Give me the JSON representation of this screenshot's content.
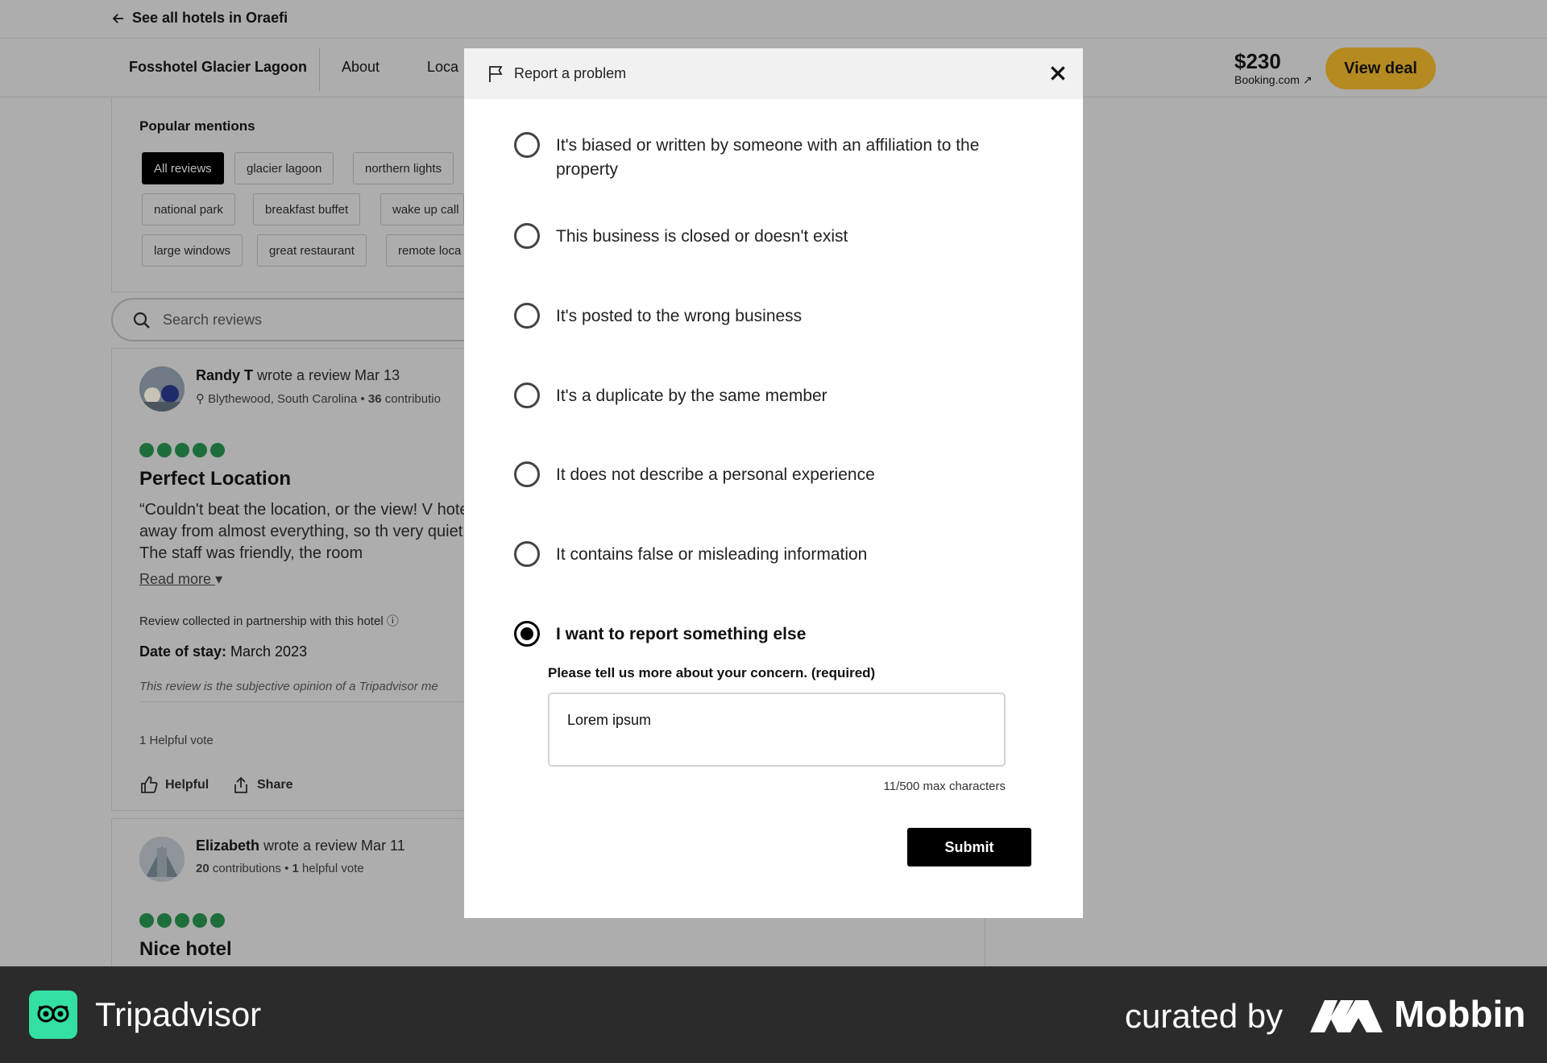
{
  "page": {
    "back_link": "See all hotels in Oraefi",
    "hotel_name": "Fosshotel Glacier Lagoon",
    "tabs": [
      "About",
      "Loca"
    ],
    "price": "$230",
    "price_source": "Booking.com ↗",
    "view_deal": "View deal",
    "popular_mentions_title": "Popular mentions",
    "chips": [
      "All reviews",
      "glacier lagoon",
      "northern lights",
      "national park",
      "breakfast buffet",
      "wake up call",
      "large windows",
      "great restaurant",
      "remote loca"
    ],
    "search_placeholder": "Search reviews"
  },
  "reviews": [
    {
      "name": "Randy T",
      "wrote": " wrote a review Mar 13",
      "location": "Blythewood, South Carolina • ",
      "contrib_count": "36",
      "contrib_label": " contributio",
      "title": "Perfect Location",
      "body": "“Couldn't beat the location, or the view! V hotel is away from almost everything, so th very quiet. The staff was friendly, the room",
      "read_more": "Read more",
      "collected": "Review collected in partnership with this hotel",
      "stay_label": "Date of stay:",
      "stay_value": " March 2023",
      "disclaimer": "This review is the subjective opinion of a Tripadvisor me",
      "helpful_votes": "1 Helpful vote",
      "helpful_btn": "Helpful",
      "share_btn": "Share",
      "rating": 5
    },
    {
      "name": "Elizabeth",
      "wrote": " wrote a review Mar 11",
      "contrib_count": "20",
      "contrib_label": " contributions • ",
      "helpful_count": "1",
      "helpful_label": " helpful vote",
      "title": "Nice hotel",
      "rating": 5
    }
  ],
  "modal": {
    "title": "Report a problem",
    "options": [
      "It's biased or written by someone with an affiliation to the property",
      "This business is closed or doesn't exist",
      "It's posted to the wrong business",
      "It's a duplicate by the same member",
      "It does not describe a personal experience",
      "It contains false or misleading information",
      "I want to report something else"
    ],
    "selected_index": 6,
    "concern_label": "Please tell us more about your concern. (required)",
    "concern_value": "Lorem ipsum",
    "char_count": "11/500 max characters",
    "submit": "Submit"
  },
  "footer": {
    "app_name": "Tripadvisor",
    "curated_by": "curated by",
    "brand": "Mobbin"
  },
  "colors": {
    "overlay": "#adadad",
    "bubble_green": "#1e6e3c",
    "view_deal": "#b48a21",
    "tripadvisor_green": "#34e0a1",
    "footer_bg": "#2b2b2b"
  }
}
